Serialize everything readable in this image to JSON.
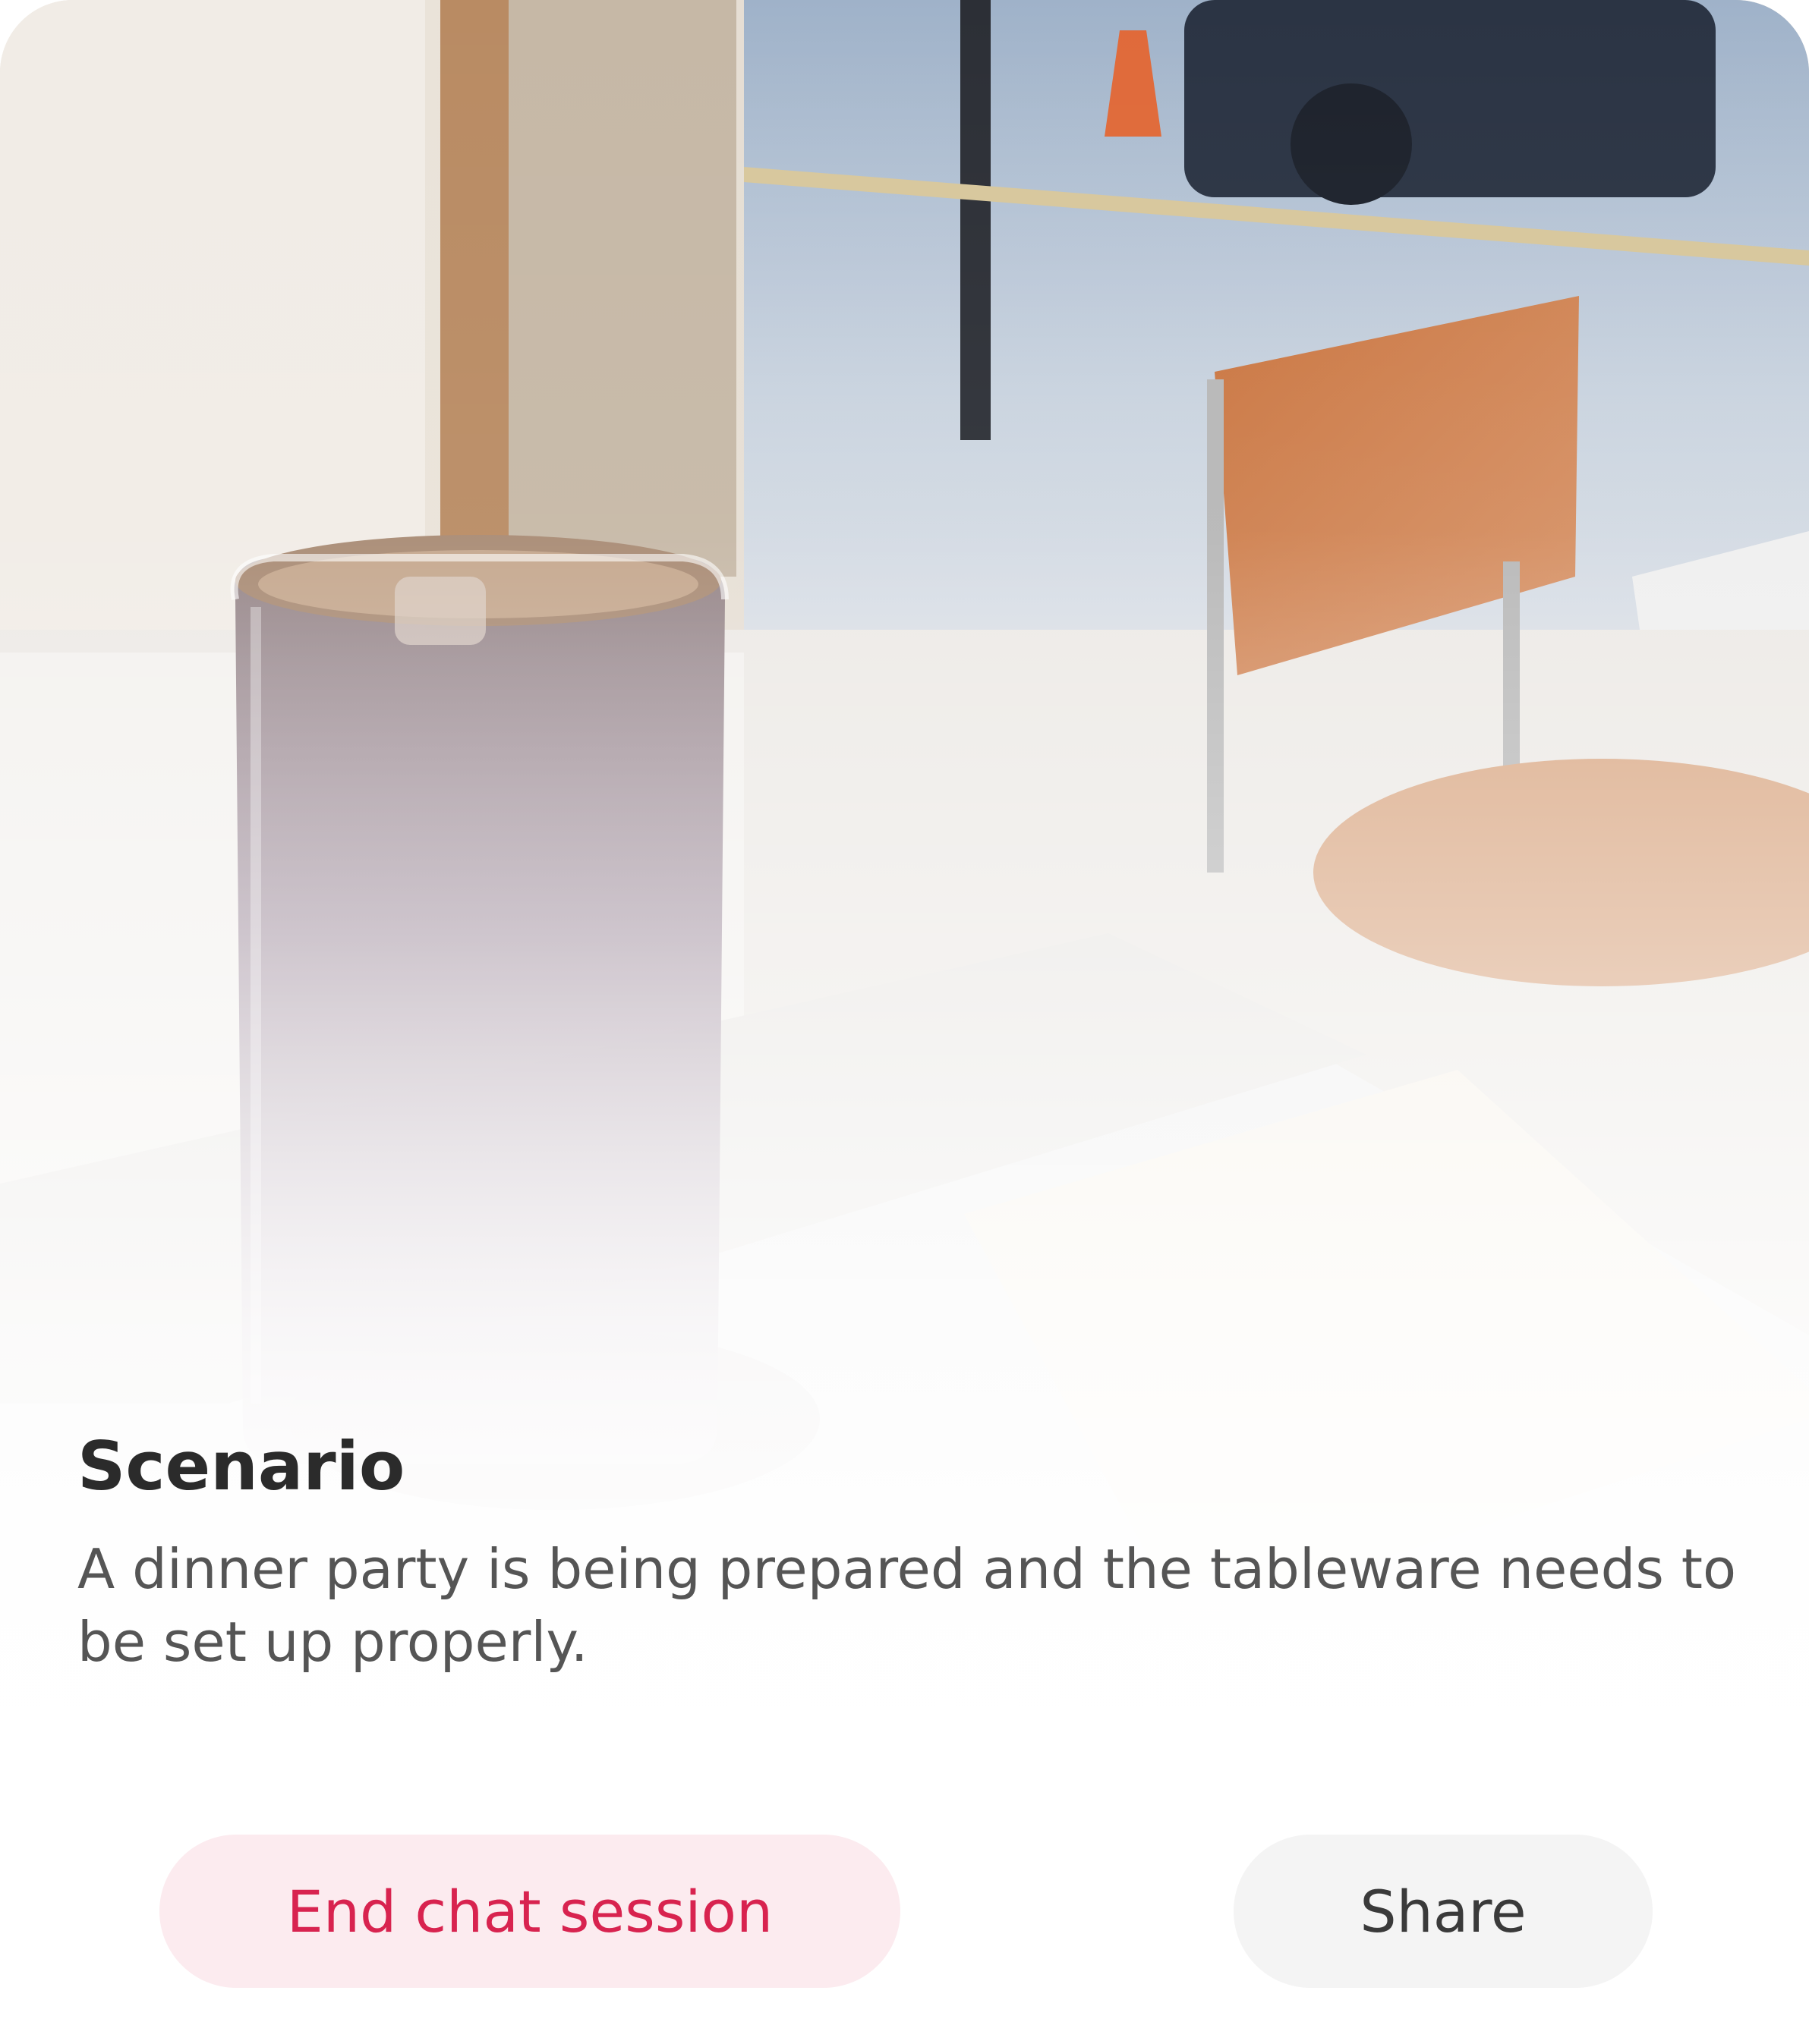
{
  "scenario": {
    "title": "Scenario",
    "description": "A dinner party is being prepared and the tableware needs to be set up properly."
  },
  "actions": {
    "end_label": "End chat session",
    "share_label": "Share"
  },
  "colors": {
    "end_text": "#d8234f",
    "end_bg": "#fcebef",
    "share_text": "#3a3a3a",
    "share_bg": "#f4f4f4",
    "title_text": "#2b2b2b",
    "body_text": "#555555"
  }
}
